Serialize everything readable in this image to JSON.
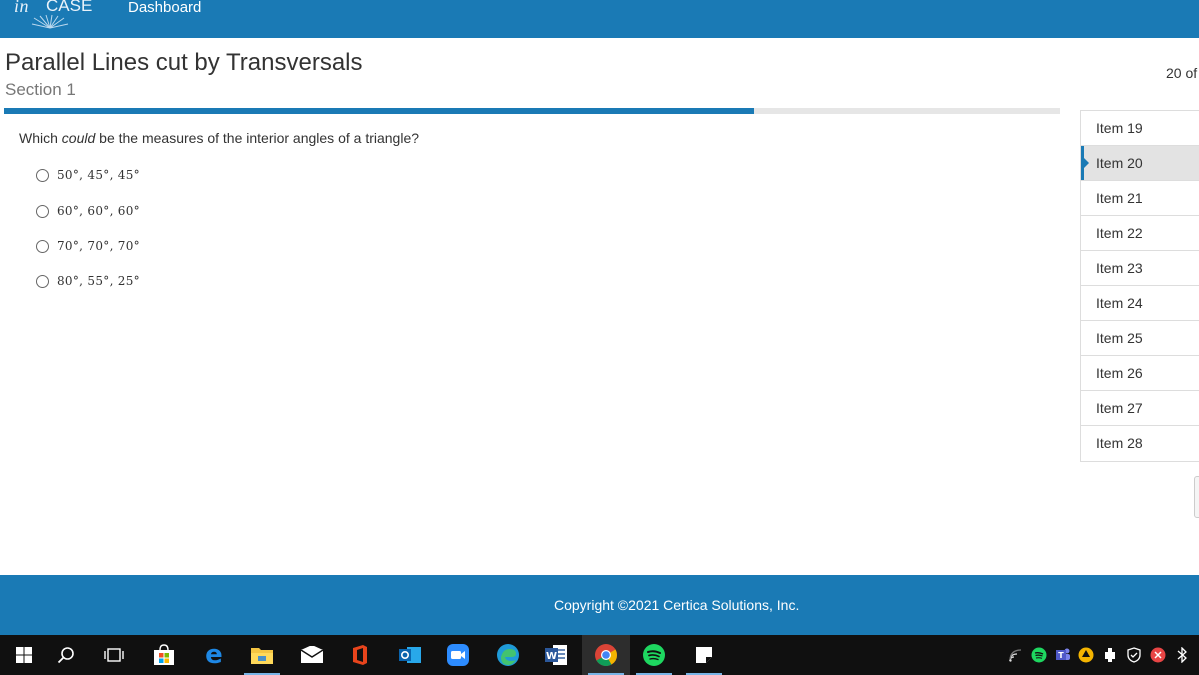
{
  "header": {
    "logo_text": "CASE",
    "logo_prefix": "in",
    "nav_dashboard": "Dashboard"
  },
  "assessment": {
    "title": "Parallel Lines cut by Transversals",
    "section": "Section 1",
    "item_count": "20 of",
    "progress_fraction": 0.71
  },
  "question": {
    "prefix": "Which ",
    "emphasis": "could",
    "suffix": " be the measures of the interior angles of a triangle?",
    "options": [
      "50°, 45°, 45°",
      "60°, 60°, 60°",
      "70°, 70°, 70°",
      "80°, 55°, 25°"
    ]
  },
  "item_list": {
    "items": [
      "Item 19",
      "Item 20",
      "Item 21",
      "Item 22",
      "Item 23",
      "Item 24",
      "Item 25",
      "Item 26",
      "Item 27",
      "Item 28"
    ],
    "active": "Item 20"
  },
  "footer": {
    "copyright": "Copyright ©2021 Certica Solutions, Inc."
  },
  "colors": {
    "brand_blue": "#1a7ab5",
    "taskbar": "#101010"
  },
  "taskbar": {
    "apps": [
      "windows-start-icon",
      "search-icon",
      "task-view-icon",
      "store-icon",
      "edge-legacy-icon",
      "file-explorer-icon",
      "mail-icon",
      "office-icon",
      "outlook-icon",
      "zoom-icon",
      "edge-icon",
      "word-icon",
      "chrome-icon",
      "spotify-icon",
      "sticky-notes-icon"
    ],
    "tray": [
      "network-icon",
      "spotify-tray-icon",
      "teams-icon",
      "google-drive-icon",
      "usb-eject-icon",
      "defender-icon",
      "antivirus-icon",
      "bluetooth-icon"
    ]
  }
}
